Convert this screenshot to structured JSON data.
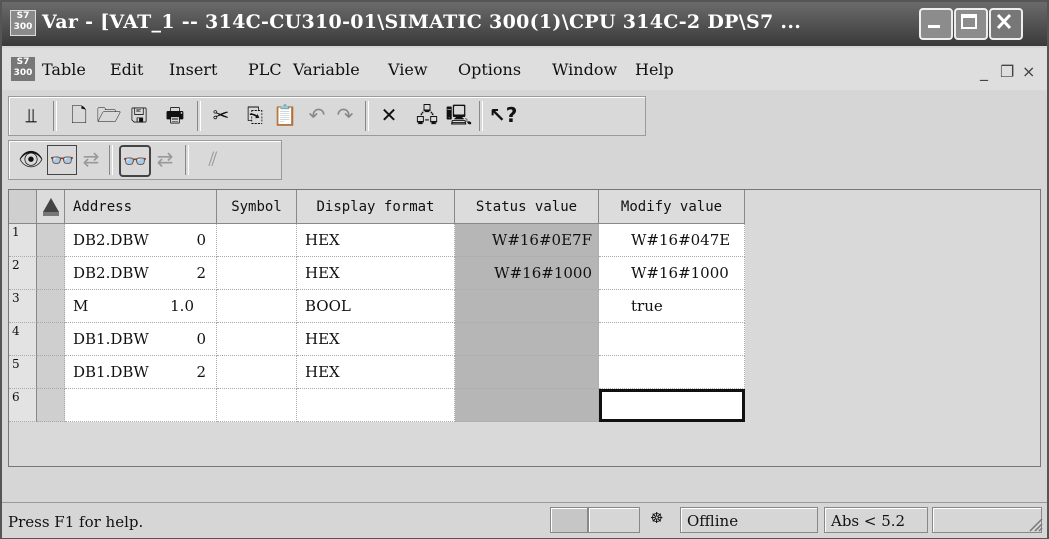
{
  "window": {
    "title": "Var - [VAT_1 -- 314C-CU310-01\\SIMATIC 300(1)\\CPU 314C-2 DP\\S7 ...",
    "app_icon_label": "S7\n300",
    "controls": [
      "minimize-icon",
      "maximize-icon",
      "close-icon"
    ]
  },
  "menu": {
    "items": [
      "Table",
      "Edit",
      "Insert",
      "PLC",
      "Variable",
      "View",
      "Options",
      "Window",
      "Help"
    ],
    "mdi_controls": [
      "_",
      "❐",
      "×"
    ]
  },
  "toolbar1": {
    "icons": [
      "pin-icon",
      "new-icon",
      "open-icon",
      "save-icon",
      "print-icon",
      "cut-icon",
      "copy-icon",
      "paste-icon",
      "undo-icon",
      "redo-icon",
      "delete-icon",
      "online-icon",
      "offline-icon",
      "help-icon"
    ]
  },
  "toolbar2": {
    "icons": [
      "monitor-icon",
      "monitor-variables-icon",
      "modify-variables-icon",
      "monitor-once-icon",
      "modify-once-icon",
      "trigger-icon"
    ]
  },
  "table": {
    "headers": [
      "Address",
      "Symbol",
      "Display format",
      "Status value",
      "Modify value"
    ],
    "rows": [
      {
        "num": "1",
        "area": "DB2.DBW",
        "offset": "0",
        "symbol": "",
        "format": "HEX",
        "status": "W#16#0E7F",
        "modify": "W#16#047E"
      },
      {
        "num": "2",
        "area": "DB2.DBW",
        "offset": "2",
        "symbol": "",
        "format": "HEX",
        "status": "W#16#1000",
        "modify": "W#16#1000"
      },
      {
        "num": "3",
        "area": "M",
        "offset": "1.0",
        "symbol": "",
        "format": "BOOL",
        "status": "",
        "modify": "true"
      },
      {
        "num": "4",
        "area": "DB1.DBW",
        "offset": "0",
        "symbol": "",
        "format": "HEX",
        "status": "",
        "modify": ""
      },
      {
        "num": "5",
        "area": "DB1.DBW",
        "offset": "2",
        "symbol": "",
        "format": "HEX",
        "status": "",
        "modify": ""
      },
      {
        "num": "6",
        "area": "",
        "offset": "",
        "symbol": "",
        "format": "",
        "status": "",
        "modify": ""
      }
    ]
  },
  "status": {
    "help": "Press F1 for help.",
    "connection": "Offline",
    "version": "Abs < 5.2"
  }
}
